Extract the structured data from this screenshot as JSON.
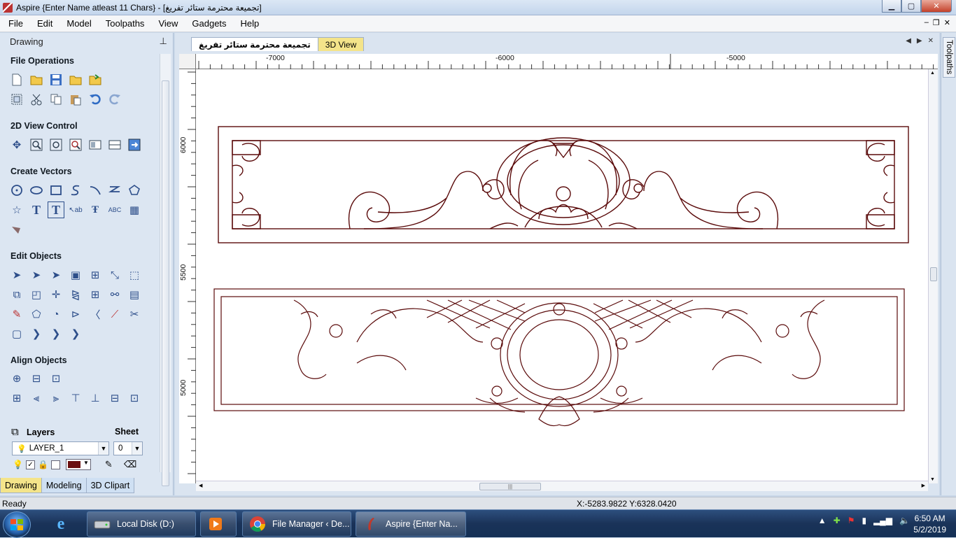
{
  "window": {
    "title": "Aspire {Enter Name atleast 11 Chars} - [تجميعة محترمة ستائر تفريغ]"
  },
  "menu": [
    "File",
    "Edit",
    "Model",
    "Toolpaths",
    "View",
    "Gadgets",
    "Help"
  ],
  "panel": {
    "title": "Drawing",
    "sections": {
      "file_ops": "File Operations",
      "view_control": "2D View Control",
      "create_vectors": "Create Vectors",
      "edit_objects": "Edit Objects",
      "align_objects": "Align Objects"
    },
    "layers": {
      "label": "Layers",
      "sheet_label": "Sheet",
      "layer_value": "LAYER_1",
      "sheet_value": "0",
      "layer_color": "#6b0f0f"
    },
    "tabs": [
      "Drawing",
      "Modeling",
      "3D Clipart"
    ]
  },
  "doc_tabs": [
    "تجميعة محترمة ستائر تفريغ",
    "3D View"
  ],
  "ruler": {
    "top": [
      "-7000",
      "-6000",
      "-5000"
    ],
    "left": [
      "6000",
      "5500",
      "5000"
    ]
  },
  "right_tab": "Toolpaths",
  "status": {
    "text": "Ready",
    "coords": "X:-5283.9822 Y:6328.0420"
  },
  "taskbar": {
    "items": [
      {
        "label": "Local Disk (D:)",
        "icon": "drive-icon"
      },
      {
        "label": "",
        "icon": "media-player-icon"
      },
      {
        "label": "File Manager ‹ De...",
        "icon": "chrome-icon"
      },
      {
        "label": "Aspire {Enter Na...",
        "icon": "aspire-icon"
      }
    ],
    "time": "6:50 AM",
    "date": "5/2/2019"
  },
  "colors": {
    "vector": "#5a0a0a",
    "tab_yellow": "#f4e48a"
  }
}
